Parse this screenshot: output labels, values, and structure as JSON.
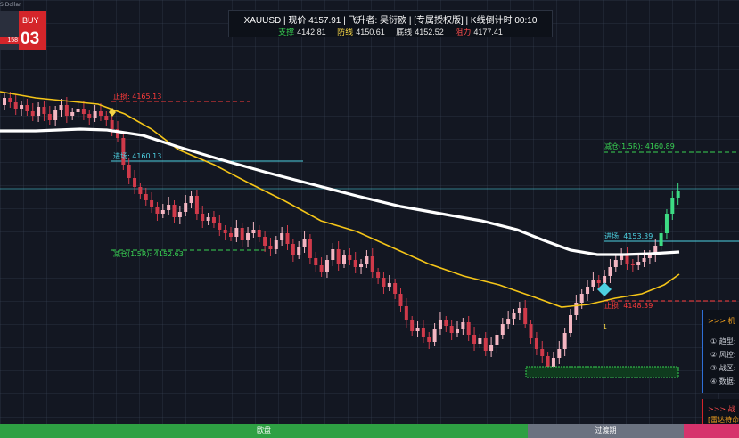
{
  "symbol_label": "S Dollar",
  "trade_panel": {
    "buy_label": "BUY",
    "price_small": "158",
    "price_big": "03"
  },
  "header": {
    "title": "XAUUSD | 现价 4157.91 | 飞升者: 吴衍欧 | [专属授权版] | K线倒计时 00:10",
    "stats": [
      {
        "key": "支撑",
        "value": "4142.81",
        "color": "#39d353"
      },
      {
        "key": "防线",
        "value": "4150.61",
        "color": "#f5d547"
      },
      {
        "key": "底线",
        "value": "4152.52",
        "color": "#e8e8e8"
      },
      {
        "key": "阻力",
        "value": "4177.41",
        "color": "#ff4d4d"
      }
    ]
  },
  "annotations": [
    {
      "text": "止损: 4165.13",
      "color": "#ff3b3b"
    },
    {
      "text": "进场: 4160.13",
      "color": "#4dd0e1"
    },
    {
      "text": "减仓(1.5R): 4152.63",
      "color": "#39d353"
    },
    {
      "text": "减仓(1.5R): 4160.89",
      "color": "#39d353"
    },
    {
      "text": "进场: 4153.39",
      "color": "#4dd0e1"
    },
    {
      "text": "止损: 4148.39",
      "color": "#ff3b3b"
    },
    {
      "text": "1",
      "color": "#f5d547"
    }
  ],
  "side_panel": {
    "title": ">>> 机",
    "items": [
      "① 趋型:",
      "② 风控:",
      "③ 战区:",
      "④ 数据:"
    ],
    "title2": ">>> 战",
    "sub2": "[雷达待命"
  },
  "sessions": [
    {
      "label": "欧盘",
      "color": "#2ea043"
    },
    {
      "label": "过渡期",
      "color": "#6b7280"
    },
    {
      "label": "",
      "color": "#d6336c"
    }
  ],
  "colors": {
    "bull": "#f4b6c2",
    "bear": "#d03a4a",
    "bull_bright": "#3ddc84",
    "ma_white": "#ffffff",
    "ma_yellow": "#f5c518"
  }
}
